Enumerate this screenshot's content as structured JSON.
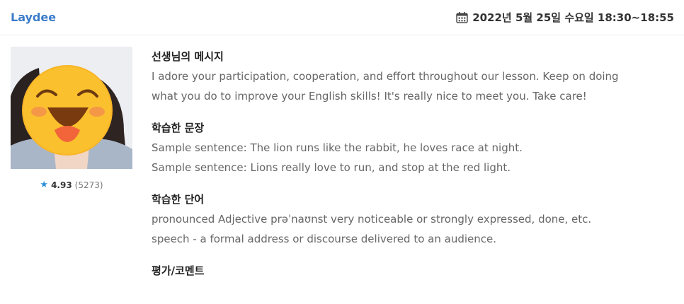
{
  "header": {
    "tutor_name": "Laydee",
    "lesson_datetime": "2022년 5월 25일 수요일 18:30~18:55",
    "calendar_icon": "calendar-icon"
  },
  "tutor": {
    "rating_score": "4.93",
    "rating_count": "(5273)",
    "star_icon": "star-icon",
    "star_color": "#2b8fd6"
  },
  "sections": {
    "message": {
      "title": "선생님의 메시지",
      "lines": [
        "I adore your participation, cooperation, and effort throughout our lesson. Keep on doing",
        "what you do to improve your English skills! It's really nice to meet you. Take care!"
      ]
    },
    "sentences": {
      "title": "학습한 문장",
      "lines": [
        "Sample sentence: The lion runs like the rabbit, he loves race at night.",
        "Sample sentence: Lions really love to run, and stop at the red light."
      ]
    },
    "words": {
      "title": "학습한 단어",
      "lines": [
        "pronounced Adjective prəˈnaʊnst very noticeable or strongly expressed, done, etc.",
        "speech - a formal address or discourse delivered to an audience."
      ]
    },
    "evaluation": {
      "title": "평가/코멘트"
    }
  },
  "colors": {
    "accent": "#3a7bc8",
    "body_text": "#666666",
    "heading_text": "#222222"
  }
}
